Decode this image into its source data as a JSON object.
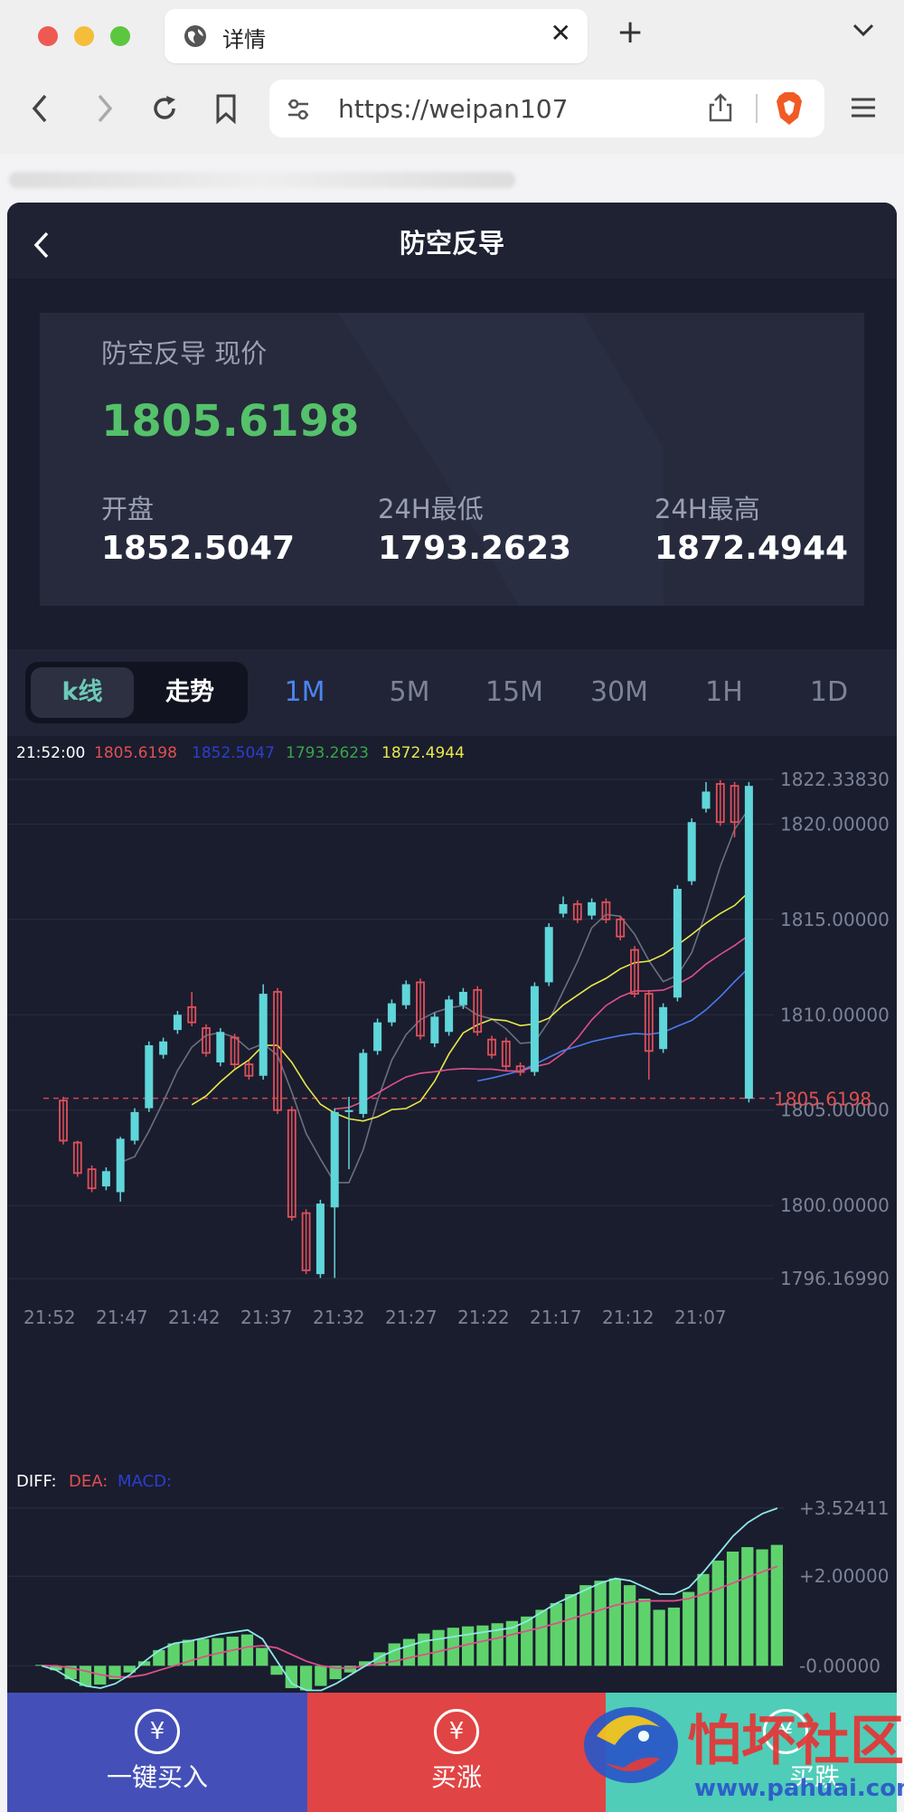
{
  "browser": {
    "tab_title": "详情",
    "url": "https://weipan107",
    "new_tab": "+",
    "close": "✕"
  },
  "app": {
    "title": "防空反导",
    "price_card": {
      "current_label": "防空反导 现价",
      "current_price": "1805.6198",
      "open_label": "开盘",
      "open_value": "1852.5047",
      "low_label": "24H最低",
      "low_value": "1793.2623",
      "high_label": "24H最高",
      "high_value": "1872.4944"
    },
    "toggle": {
      "kline": "k线",
      "trend": "走势"
    },
    "periods": [
      "1M",
      "5M",
      "15M",
      "30M",
      "1H",
      "1D"
    ],
    "active_period": "1M",
    "footer": {
      "buy_one": "一键买入",
      "buy_up": "买涨",
      "buy_down": "买跌",
      "icon_symbol": "¥"
    }
  },
  "colors": {
    "up": "#5fd6d9",
    "down": "#e0505a",
    "green": "#55c16a",
    "active_period": "#4a86f0",
    "footer_blue": "#4450b8",
    "footer_red": "#e14444",
    "footer_teal": "#4fcdb8"
  },
  "chart_data": [
    {
      "type": "candlestick",
      "info_line": {
        "time": "21:52:00",
        "v1": "1805.6198",
        "v2": "1852.5047",
        "v3": "1793.2623",
        "v4": "1872.4944"
      },
      "ylim": [
        1796.1699,
        1822.3383
      ],
      "y_tick_labels": [
        "1822.33830",
        "1820.00000",
        "1815.00000",
        "1810.00000",
        "1805.00000",
        "1800.00000",
        "1796.16990"
      ],
      "y_ticks": [
        1822.3383,
        1820,
        1815,
        1810,
        1805,
        1800,
        1796.1699
      ],
      "current_price_label": "1805.6198",
      "current_price": 1805.6198,
      "x_tick_labels": [
        "21:52",
        "21:47",
        "21:42",
        "21:37",
        "21:32",
        "21:27",
        "21:22",
        "21:17",
        "21:12",
        "21:07"
      ],
      "candles": [
        {
          "o": 1805.5,
          "c": 1803.4,
          "h": 1805.7,
          "l": 1803.2
        },
        {
          "o": 1803.3,
          "c": 1801.7,
          "h": 1803.4,
          "l": 1801.5
        },
        {
          "o": 1801.9,
          "c": 1800.9,
          "h": 1802.1,
          "l": 1800.7
        },
        {
          "o": 1801.0,
          "c": 1801.8,
          "h": 1802.0,
          "l": 1800.8
        },
        {
          "o": 1800.7,
          "c": 1803.5,
          "h": 1803.6,
          "l": 1800.2
        },
        {
          "o": 1803.4,
          "c": 1804.9,
          "h": 1805.1,
          "l": 1803.2
        },
        {
          "o": 1805.1,
          "c": 1808.4,
          "h": 1808.6,
          "l": 1804.9
        },
        {
          "o": 1807.9,
          "c": 1808.6,
          "h": 1808.8,
          "l": 1807.7
        },
        {
          "o": 1809.2,
          "c": 1810.0,
          "h": 1810.2,
          "l": 1809.0
        },
        {
          "o": 1810.4,
          "c": 1809.6,
          "h": 1811.2,
          "l": 1809.4
        },
        {
          "o": 1809.3,
          "c": 1808.0,
          "h": 1809.5,
          "l": 1807.8
        },
        {
          "o": 1807.5,
          "c": 1809.1,
          "h": 1809.3,
          "l": 1807.3
        },
        {
          "o": 1808.8,
          "c": 1807.4,
          "h": 1809.0,
          "l": 1807.2
        },
        {
          "o": 1807.4,
          "c": 1806.8,
          "h": 1807.6,
          "l": 1806.6
        },
        {
          "o": 1806.8,
          "c": 1811.1,
          "h": 1811.6,
          "l": 1806.6
        },
        {
          "o": 1811.2,
          "c": 1805.0,
          "h": 1811.4,
          "l": 1804.8
        },
        {
          "o": 1805.0,
          "c": 1799.4,
          "h": 1805.2,
          "l": 1799.2
        },
        {
          "o": 1799.6,
          "c": 1796.6,
          "h": 1799.8,
          "l": 1796.4
        },
        {
          "o": 1796.4,
          "c": 1800.1,
          "h": 1800.3,
          "l": 1796.2
        },
        {
          "o": 1799.9,
          "c": 1804.9,
          "h": 1805.1,
          "l": 1796.2
        },
        {
          "o": 1804.9,
          "c": 1805.0,
          "h": 1805.7,
          "l": 1801.9
        },
        {
          "o": 1804.8,
          "c": 1808.0,
          "h": 1808.2,
          "l": 1804.6
        },
        {
          "o": 1808.1,
          "c": 1809.6,
          "h": 1809.8,
          "l": 1807.9
        },
        {
          "o": 1809.6,
          "c": 1810.6,
          "h": 1810.8,
          "l": 1809.4
        },
        {
          "o": 1810.5,
          "c": 1811.6,
          "h": 1811.8,
          "l": 1810.3
        },
        {
          "o": 1811.7,
          "c": 1808.9,
          "h": 1811.9,
          "l": 1808.7
        },
        {
          "o": 1808.5,
          "c": 1809.9,
          "h": 1810.1,
          "l": 1808.3
        },
        {
          "o": 1809.1,
          "c": 1810.8,
          "h": 1811.0,
          "l": 1808.9
        },
        {
          "o": 1810.5,
          "c": 1811.2,
          "h": 1811.4,
          "l": 1810.3
        },
        {
          "o": 1811.3,
          "c": 1809.1,
          "h": 1811.5,
          "l": 1808.9
        },
        {
          "o": 1808.7,
          "c": 1807.9,
          "h": 1808.9,
          "l": 1807.7
        },
        {
          "o": 1808.6,
          "c": 1807.3,
          "h": 1808.8,
          "l": 1807.1
        },
        {
          "o": 1807.3,
          "c": 1807.0,
          "h": 1807.5,
          "l": 1806.8
        },
        {
          "o": 1807.0,
          "c": 1811.5,
          "h": 1811.7,
          "l": 1806.8
        },
        {
          "o": 1811.7,
          "c": 1814.6,
          "h": 1814.8,
          "l": 1811.5
        },
        {
          "o": 1815.3,
          "c": 1815.8,
          "h": 1816.2,
          "l": 1815.1
        },
        {
          "o": 1815.8,
          "c": 1815.0,
          "h": 1816.0,
          "l": 1814.8
        },
        {
          "o": 1815.2,
          "c": 1815.9,
          "h": 1816.1,
          "l": 1815.0
        },
        {
          "o": 1815.9,
          "c": 1815.0,
          "h": 1816.1,
          "l": 1814.8
        },
        {
          "o": 1815.0,
          "c": 1814.1,
          "h": 1815.2,
          "l": 1813.9
        },
        {
          "o": 1813.4,
          "c": 1811.1,
          "h": 1813.6,
          "l": 1810.9
        },
        {
          "o": 1811.1,
          "c": 1808.1,
          "h": 1811.3,
          "l": 1806.6
        },
        {
          "o": 1808.2,
          "c": 1810.4,
          "h": 1810.6,
          "l": 1808.0
        },
        {
          "o": 1810.9,
          "c": 1816.6,
          "h": 1816.8,
          "l": 1810.7
        },
        {
          "o": 1817.0,
          "c": 1820.1,
          "h": 1820.3,
          "l": 1816.8
        },
        {
          "o": 1820.8,
          "c": 1821.7,
          "h": 1822.2,
          "l": 1820.6
        },
        {
          "o": 1822.1,
          "c": 1820.1,
          "h": 1822.3,
          "l": 1819.9
        },
        {
          "o": 1822.0,
          "c": 1820.1,
          "h": 1822.2,
          "l": 1819.3
        },
        {
          "o": 1805.6,
          "c": 1822.0,
          "h": 1822.2,
          "l": 1805.4
        }
      ]
    },
    {
      "type": "macd",
      "legend": [
        "DIFF:",
        "DEA:",
        "MACD:"
      ],
      "y_tick_labels": [
        "+3.52411",
        "+2.00000",
        "-0.00000"
      ],
      "y_ticks": [
        3.52411,
        2,
        0
      ],
      "ylim": [
        -0.6,
        3.6
      ],
      "histogram": [
        0.02,
        -0.1,
        -0.3,
        -0.45,
        -0.42,
        -0.3,
        -0.15,
        0.1,
        0.35,
        0.5,
        0.58,
        0.6,
        0.62,
        0.65,
        0.7,
        0.4,
        -0.2,
        -0.5,
        -0.55,
        -0.45,
        -0.3,
        -0.15,
        0.1,
        0.3,
        0.5,
        0.6,
        0.72,
        0.8,
        0.85,
        0.88,
        0.9,
        0.95,
        1.0,
        1.1,
        1.25,
        1.4,
        1.6,
        1.8,
        1.9,
        1.95,
        1.8,
        1.5,
        1.25,
        1.3,
        1.65,
        2.05,
        2.35,
        2.55,
        2.65,
        2.6,
        2.7
      ],
      "diff": [
        0.0,
        -0.1,
        -0.3,
        -0.45,
        -0.5,
        -0.4,
        -0.2,
        0.1,
        0.35,
        0.5,
        0.55,
        0.62,
        0.7,
        0.75,
        0.8,
        0.6,
        0.1,
        -0.4,
        -0.55,
        -0.55,
        -0.4,
        -0.2,
        0.0,
        0.2,
        0.35,
        0.45,
        0.55,
        0.6,
        0.65,
        0.7,
        0.75,
        0.8,
        0.85,
        1.0,
        1.2,
        1.4,
        1.55,
        1.7,
        1.85,
        1.95,
        1.9,
        1.75,
        1.6,
        1.6,
        1.75,
        2.1,
        2.5,
        2.9,
        3.2,
        3.4,
        3.52
      ],
      "dea": [
        0.0,
        0.0,
        -0.05,
        -0.12,
        -0.2,
        -0.25,
        -0.25,
        -0.2,
        -0.1,
        0.0,
        0.1,
        0.2,
        0.28,
        0.35,
        0.42,
        0.45,
        0.4,
        0.25,
        0.1,
        0.0,
        -0.05,
        -0.05,
        0.0,
        0.05,
        0.1,
        0.18,
        0.25,
        0.32,
        0.4,
        0.48,
        0.55,
        0.62,
        0.7,
        0.78,
        0.86,
        0.95,
        1.05,
        1.15,
        1.25,
        1.35,
        1.42,
        1.45,
        1.45,
        1.45,
        1.5,
        1.6,
        1.72,
        1.85,
        1.98,
        2.1,
        2.22
      ]
    }
  ]
}
